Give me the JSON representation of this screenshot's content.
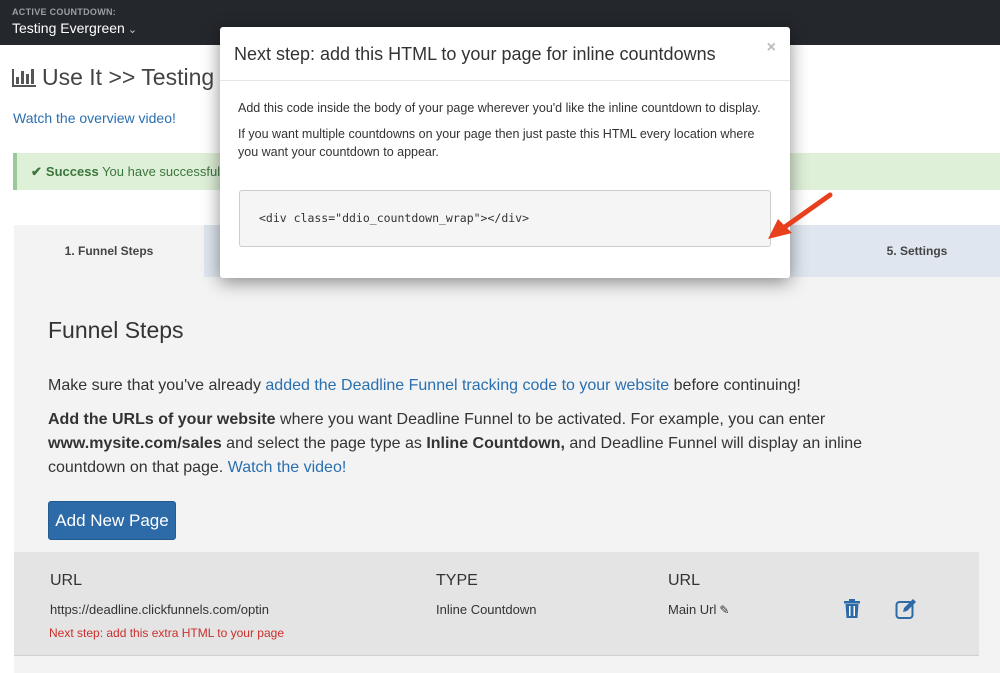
{
  "topbar": {
    "label": "ACTIVE COUNTDOWN:",
    "countdown_name": "Testing Evergreen",
    "chevron_icon": "chevron-down-icon"
  },
  "page": {
    "title": "Use It >> Testing Ev",
    "overview_link": "Watch the overview video!"
  },
  "alert": {
    "check": "✔",
    "strong": "Success",
    "text": "You have successfully"
  },
  "tabs": [
    {
      "label": "1. Funnel Steps"
    },
    {
      "label": "5. Settings"
    }
  ],
  "funnel": {
    "title": "Funnel Steps",
    "p1_prefix": "Make sure that you've already ",
    "p1_link": "added the Deadline Funnel tracking code to your website",
    "p1_suffix": " before continuing!",
    "p2_b1": "Add the URLs of your website",
    "p2_t1": " where you want Deadline Funnel to be activated. For example, you can enter ",
    "p2_b2": "www.mysite.com/sales",
    "p2_t2": " and select the page type as ",
    "p2_b3": "Inline Countdown,",
    "p2_t3": " and Deadline Funnel will display an inline countdown on that page. ",
    "p2_link": "Watch the video!",
    "add_button": "Add New Page"
  },
  "table": {
    "headers": [
      "URL",
      "TYPE",
      "URL"
    ],
    "row": {
      "url": "https://deadline.clickfunnels.com/optin",
      "type": "Inline Countdown",
      "url_type": "Main Url",
      "next_step": "Next step: add this extra HTML to your page"
    }
  },
  "modal": {
    "title": "Next step: add this HTML to your page for inline countdowns",
    "close": "×",
    "p1": "Add this code inside the body of your page wherever you'd like the inline countdown to display.",
    "p2": "If you want multiple countdowns on your page then just paste this HTML every location where you want your countdown to appear.",
    "code": "<div class=\"ddio_countdown_wrap\"></div>"
  },
  "colors": {
    "accent": "#2d6aa8",
    "arrow": "#e8401c",
    "danger": "#c9302c"
  }
}
